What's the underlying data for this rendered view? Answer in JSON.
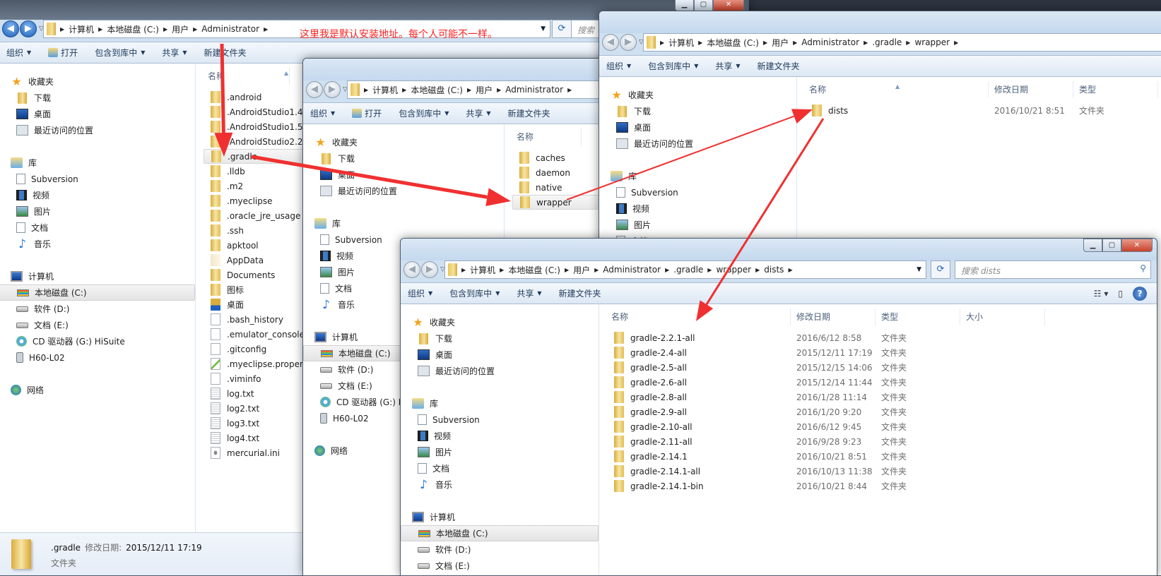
{
  "annotation": "这里我是默认安装地址。每个人可能不一样。",
  "colors": {
    "arrow": "#f03030",
    "annotation": "#ff2020",
    "selection": "#e8e8e8",
    "toolbar": "#dde8f4"
  },
  "nav": {
    "groups": [
      {
        "label": "收藏夹",
        "icon": "star-icon",
        "items": [
          {
            "label": "下载",
            "icon": "downloads-folder-icon"
          },
          {
            "label": "桌面",
            "icon": "desktop-icon"
          },
          {
            "label": "最近访问的位置",
            "icon": "recent-places-icon"
          }
        ]
      },
      {
        "label": "库",
        "icon": "library-icon",
        "items": [
          {
            "label": "Subversion",
            "icon": "document-library-icon"
          },
          {
            "label": "视频",
            "icon": "video-icon"
          },
          {
            "label": "图片",
            "icon": "picture-icon"
          },
          {
            "label": "文档",
            "icon": "document-icon"
          },
          {
            "label": "音乐",
            "icon": "music-icon"
          }
        ]
      },
      {
        "label": "计算机",
        "icon": "computer-icon",
        "items": [
          {
            "label": "本地磁盘 (C:)",
            "icon": "system-drive-icon"
          },
          {
            "label": "软件 (D:)",
            "icon": "drive-icon"
          },
          {
            "label": "文档 (E:)",
            "icon": "drive-icon"
          },
          {
            "label": "CD 驱动器 (G:) HiSuite",
            "icon": "cd-drive-icon"
          },
          {
            "label": "H60-L02",
            "icon": "phone-icon"
          }
        ]
      },
      {
        "label": "网络",
        "icon": "network-icon",
        "items": []
      }
    ]
  },
  "windows": [
    {
      "breadcrumb": [
        "计算机",
        "本地磁盘 (C:)",
        "用户",
        "Administrator"
      ],
      "search_placeholder": "搜索",
      "toolbar": [
        {
          "label": "组织",
          "dropdown": true
        },
        {
          "label": "打开",
          "icon": "open-icon"
        },
        {
          "label": "包含到库中",
          "dropdown": true
        },
        {
          "label": "共享",
          "dropdown": true
        },
        {
          "label": "新建文件夹"
        }
      ],
      "columns": [
        "名称"
      ],
      "selected_nav": "本地磁盘 (C:)",
      "selected_file": ".gradle",
      "files": [
        {
          "name": ".android",
          "type": "folder"
        },
        {
          "name": ".AndroidStudio1.4",
          "type": "folder"
        },
        {
          "name": ".AndroidStudio1.5",
          "type": "folder"
        },
        {
          "name": ".AndroidStudio2.2",
          "type": "folder"
        },
        {
          "name": ".gradle",
          "type": "folder"
        },
        {
          "name": ".lldb",
          "type": "folder"
        },
        {
          "name": ".m2",
          "type": "folder"
        },
        {
          "name": ".myeclipse",
          "type": "folder"
        },
        {
          "name": ".oracle_jre_usage",
          "type": "folder"
        },
        {
          "name": ".ssh",
          "type": "folder"
        },
        {
          "name": "apktool",
          "type": "folder"
        },
        {
          "name": "AppData",
          "type": "folder-hidden"
        },
        {
          "name": "Documents",
          "type": "folder"
        },
        {
          "name": "图标",
          "type": "folder"
        },
        {
          "name": "桌面",
          "type": "folder-desktop"
        },
        {
          "name": ".bash_history",
          "type": "file"
        },
        {
          "name": ".emulator_console_auth_token",
          "type": "file"
        },
        {
          "name": ".gitconfig",
          "type": "file"
        },
        {
          "name": ".myeclipse.properties",
          "type": "file-props"
        },
        {
          "name": ".viminfo",
          "type": "file"
        },
        {
          "name": "log.txt",
          "type": "file-text"
        },
        {
          "name": "log2.txt",
          "type": "file-text"
        },
        {
          "name": "log3.txt",
          "type": "file-text"
        },
        {
          "name": "log4.txt",
          "type": "file-text"
        },
        {
          "name": "mercurial.ini",
          "type": "file-ini"
        }
      ],
      "status": {
        "name": ".gradle",
        "date_label": "修改日期:",
        "date": "2015/12/11 17:19",
        "type": "文件夹"
      }
    },
    {
      "breadcrumb": [
        "计算机",
        "本地磁盘 (C:)",
        "用户",
        "Administrator"
      ],
      "toolbar": [
        {
          "label": "组织",
          "dropdown": true
        },
        {
          "label": "打开",
          "icon": "open-icon"
        },
        {
          "label": "包含到库中",
          "dropdown": true
        },
        {
          "label": "共享",
          "dropdown": true
        },
        {
          "label": "新建文件夹"
        }
      ],
      "columns": [
        "名称"
      ],
      "selected_nav": "本地磁盘 (C:)",
      "selected_file": "wrapper",
      "files": [
        {
          "name": "caches",
          "type": "folder"
        },
        {
          "name": "daemon",
          "type": "folder"
        },
        {
          "name": "native",
          "type": "folder"
        },
        {
          "name": "wrapper",
          "type": "folder"
        }
      ]
    },
    {
      "breadcrumb": [
        "计算机",
        "本地磁盘 (C:)",
        "用户",
        "Administrator",
        ".gradle",
        "wrapper"
      ],
      "toolbar": [
        {
          "label": "组织",
          "dropdown": true
        },
        {
          "label": "包含到库中",
          "dropdown": true
        },
        {
          "label": "共享",
          "dropdown": true
        },
        {
          "label": "新建文件夹"
        }
      ],
      "columns": [
        "名称",
        "修改日期",
        "类型"
      ],
      "files": [
        {
          "name": "dists",
          "type": "folder",
          "date": "2016/10/21 8:51",
          "kind": "文件夹"
        }
      ]
    },
    {
      "breadcrumb": [
        "计算机",
        "本地磁盘 (C:)",
        "用户",
        "Administrator",
        ".gradle",
        "wrapper",
        "dists"
      ],
      "search_placeholder": "搜索 dists",
      "toolbar": [
        {
          "label": "组织",
          "dropdown": true
        },
        {
          "label": "包含到库中",
          "dropdown": true
        },
        {
          "label": "共享",
          "dropdown": true
        },
        {
          "label": "新建文件夹"
        }
      ],
      "columns": [
        "名称",
        "修改日期",
        "类型",
        "大小"
      ],
      "selected_nav": "本地磁盘 (C:)",
      "files": [
        {
          "name": "gradle-2.2.1-all",
          "type": "folder",
          "date": "2016/6/12 8:58",
          "kind": "文件夹"
        },
        {
          "name": "gradle-2.4-all",
          "type": "folder",
          "date": "2015/12/11 17:19",
          "kind": "文件夹"
        },
        {
          "name": "gradle-2.5-all",
          "type": "folder",
          "date": "2015/12/15 14:06",
          "kind": "文件夹"
        },
        {
          "name": "gradle-2.6-all",
          "type": "folder",
          "date": "2015/12/14 11:44",
          "kind": "文件夹"
        },
        {
          "name": "gradle-2.8-all",
          "type": "folder",
          "date": "2016/1/28 11:14",
          "kind": "文件夹"
        },
        {
          "name": "gradle-2.9-all",
          "type": "folder",
          "date": "2016/1/20 9:20",
          "kind": "文件夹"
        },
        {
          "name": "gradle-2.10-all",
          "type": "folder",
          "date": "2016/6/12 9:45",
          "kind": "文件夹"
        },
        {
          "name": "gradle-2.11-all",
          "type": "folder",
          "date": "2016/9/28 9:23",
          "kind": "文件夹"
        },
        {
          "name": "gradle-2.14.1",
          "type": "folder",
          "date": "2016/10/21 8:51",
          "kind": "文件夹"
        },
        {
          "name": "gradle-2.14.1-all",
          "type": "folder",
          "date": "2016/10/13 11:38",
          "kind": "文件夹"
        },
        {
          "name": "gradle-2.14.1-bin",
          "type": "folder",
          "date": "2016/10/21 8:44",
          "kind": "文件夹"
        }
      ]
    }
  ]
}
